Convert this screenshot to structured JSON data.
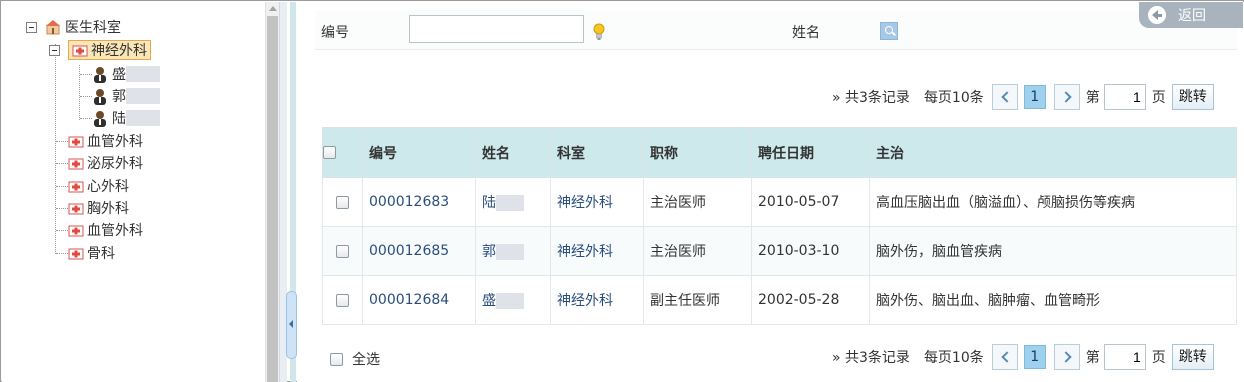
{
  "tree": {
    "root_label": "医生科室",
    "selected_dept": "神经外科",
    "doctors": [
      "盛",
      "郭",
      "陆"
    ],
    "departments": [
      "血管外科",
      "泌尿外科",
      "心外科",
      "胸外科",
      "血管外科",
      "骨科"
    ]
  },
  "search": {
    "id_label": "编号",
    "id_value": "",
    "name_label": "姓名",
    "back_label": "返回"
  },
  "pager": {
    "summary": "» 共3条记录",
    "per_page": "每页10条",
    "current_page": "1",
    "page_prefix": "第",
    "page_input": "1",
    "page_suffix": "页",
    "jump_label": "跳转"
  },
  "table": {
    "headers": [
      "编号",
      "姓名",
      "科室",
      "职称",
      "聘任日期",
      "主治"
    ],
    "rows": [
      {
        "id": "000012683",
        "name": "陆",
        "dept": "神经外科",
        "title": "主治医师",
        "date": "2010-05-07",
        "specialty": "高血压脑出血（脑溢血）、颅脑损伤等疾病"
      },
      {
        "id": "000012685",
        "name": "郭",
        "dept": "神经外科",
        "title": "主治医师",
        "date": "2010-03-10",
        "specialty": "脑外伤，脑血管疾病"
      },
      {
        "id": "000012684",
        "name": "盛",
        "dept": "神经外科",
        "title": "副主任医师",
        "date": "2002-05-28",
        "specialty": "脑外伤、脑出血、脑肿瘤、血管畸形"
      }
    ],
    "select_all_label": "全选"
  },
  "colors": {
    "header_bg": "#cde9ec",
    "link": "#2a4d80",
    "selected_bg": "#fbe6b7"
  }
}
